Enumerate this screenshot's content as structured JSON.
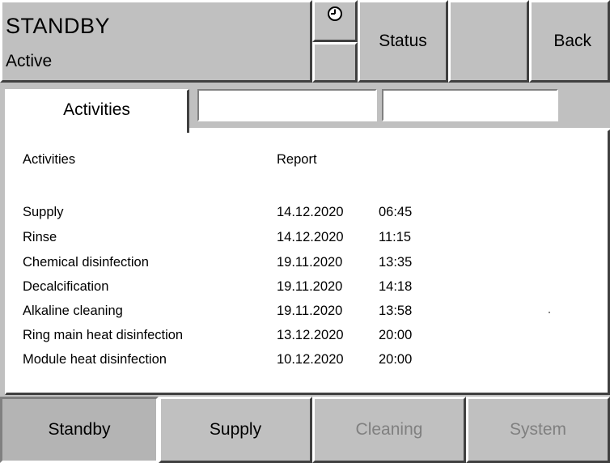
{
  "header": {
    "state": "STANDBY",
    "substate": "Active",
    "clock_icon": "clock-icon",
    "status_label": "Status",
    "blank_label": "",
    "back_label": "Back"
  },
  "tabs": [
    {
      "label": "Activities",
      "active": true
    },
    {
      "label": "",
      "active": false
    },
    {
      "label": "",
      "active": false
    }
  ],
  "table": {
    "headers": {
      "activity": "Activities",
      "report": "Report"
    },
    "rows": [
      {
        "activity": "Supply",
        "date": "14.12.2020",
        "time": "06:45"
      },
      {
        "activity": "Rinse",
        "date": "14.12.2020",
        "time": "11:15"
      },
      {
        "activity": "Chemical disinfection",
        "date": "19.11.2020",
        "time": "13:35"
      },
      {
        "activity": "Decalcification",
        "date": "19.11.2020",
        "time": "14:18"
      },
      {
        "activity": "Alkaline cleaning",
        "date": "19.11.2020",
        "time": "13:58"
      },
      {
        "activity": "Ring main heat disinfection",
        "date": "13.12.2020",
        "time": "20:00"
      },
      {
        "activity": "Module heat disinfection",
        "date": "10.12.2020",
        "time": "20:00"
      }
    ]
  },
  "nav": {
    "standby": "Standby",
    "supply": "Supply",
    "cleaning": "Cleaning",
    "system": "System"
  },
  "colors": {
    "panel_gray": "#c0c0c0",
    "disabled_text": "#808080"
  }
}
